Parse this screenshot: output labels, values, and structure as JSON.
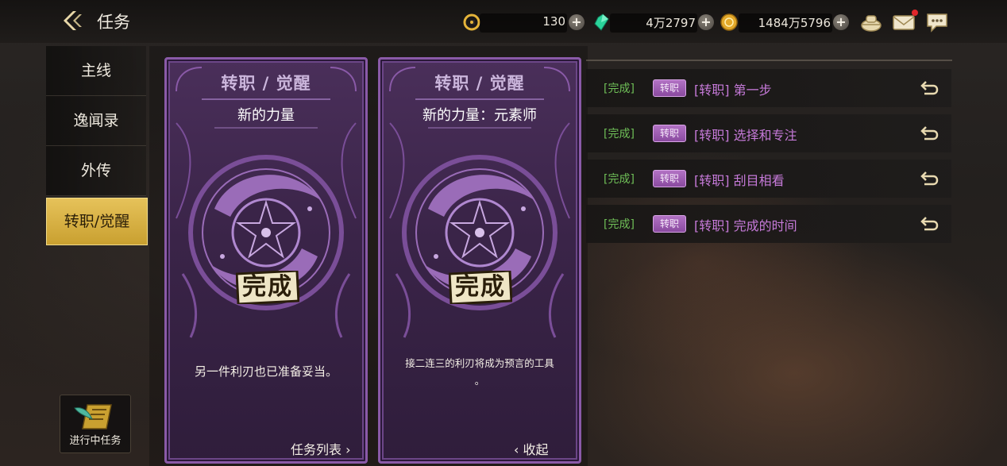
{
  "header": {
    "title": "任务",
    "back_icon": "back-chevron-icon",
    "currencies": [
      {
        "name": "ticket",
        "icon": "gold-c-icon",
        "value": "130"
      },
      {
        "name": "gem",
        "icon": "green-gem-icon",
        "value": "4万2797"
      },
      {
        "name": "coin",
        "icon": "gold-coin-icon",
        "value": "1484万5796"
      }
    ],
    "plus_label": "+",
    "icons": [
      "bag-icon",
      "mail-icon",
      "chat-icon"
    ]
  },
  "sidebar": {
    "items": [
      {
        "label": "主线",
        "active": false
      },
      {
        "label": "逸闻录",
        "active": false
      },
      {
        "label": "外传",
        "active": false
      },
      {
        "label": "转职/觉醒",
        "active": true
      }
    ],
    "ongoing_label": "进行中任务"
  },
  "cards": [
    {
      "title": "转职 / 觉醒",
      "subtitle": "新的力量",
      "stamp": "完成",
      "description": "另一件利刃也已准备妥当。",
      "link_label": "任务列表",
      "link_icon": "chevron-right-icon"
    },
    {
      "title": "转职 / 觉醒",
      "subtitle": "新的力量：元素师",
      "stamp": "完成",
      "description": "接二连三的利刃将成为预言的工具\n。",
      "link_label": "收起",
      "link_icon": "chevron-left-icon"
    }
  ],
  "quests": [
    {
      "status": "[完成]",
      "tag": "转职",
      "title": "[转职] 第一步"
    },
    {
      "status": "[完成]",
      "tag": "转职",
      "title": "[转职] 选择和专注"
    },
    {
      "status": "[完成]",
      "tag": "转职",
      "title": "[转职] 刮目相看"
    },
    {
      "status": "[完成]",
      "tag": "转职",
      "title": "[转职] 完成的时间"
    }
  ],
  "colors": {
    "accent_gold": "#e6c25a",
    "card_purple": "#8a5aa8",
    "status_green": "#6fbf57",
    "quest_title_purple": "#c67ad9",
    "notification_red": "#e0262a"
  }
}
